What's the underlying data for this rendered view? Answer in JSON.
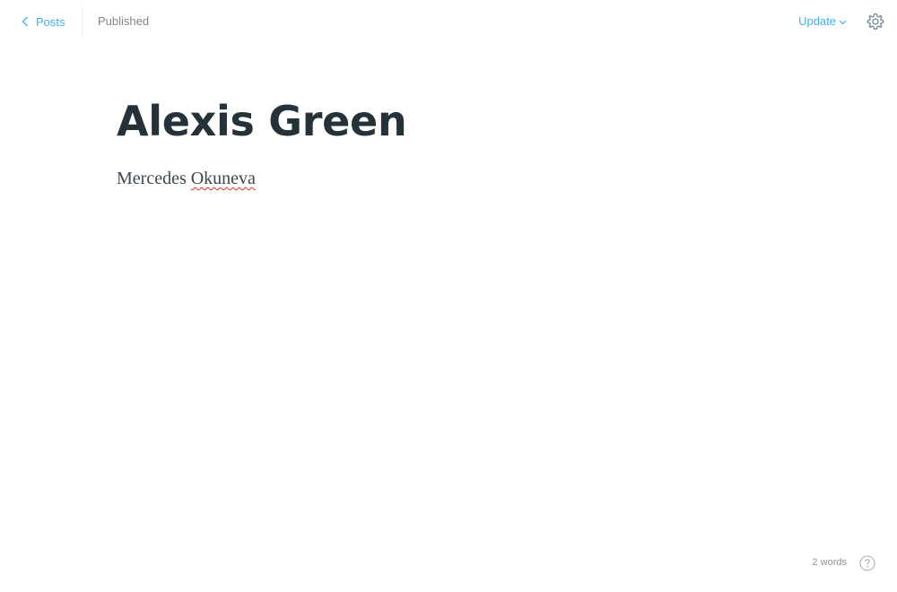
{
  "header": {
    "back_label": "Posts",
    "status": "Published",
    "update_label": "Update"
  },
  "icons": {
    "back": "chevron-left-icon",
    "update_caret": "chevron-down-icon",
    "settings": "gear-icon",
    "help": "question-circle-icon"
  },
  "editor": {
    "title": "Alexis Green",
    "body_word_1": "Mercedes",
    "body_word_2": "Okuneva"
  },
  "footer": {
    "word_count": "2 words"
  },
  "colors": {
    "accent": "#3eb0ef",
    "title": "#26323a",
    "muted": "#7d878a",
    "spelling_error": "#d62d20"
  }
}
